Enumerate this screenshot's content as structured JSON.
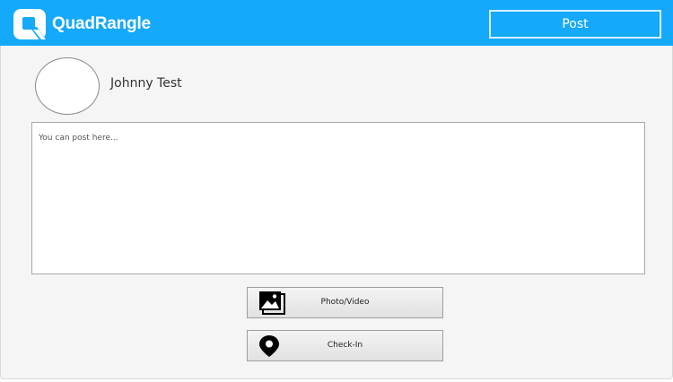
{
  "header": {
    "brand": "QuadRangle",
    "post_label": "Post",
    "accent": "#15a9fb"
  },
  "profile": {
    "name": "Johnny Test"
  },
  "composer": {
    "placeholder": "You can post here..."
  },
  "actions": {
    "photo_label": "Photo/Video",
    "photo_icon": "photo-gallery-icon",
    "checkin_label": "Check-In",
    "checkin_icon": "map-pin-icon"
  }
}
